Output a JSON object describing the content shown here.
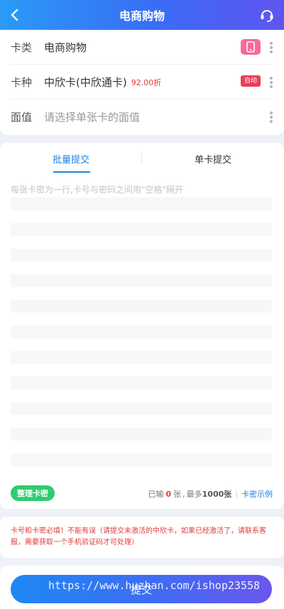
{
  "header": {
    "title": "电商购物",
    "back_icon": "chevron-left-icon",
    "service_icon": "headset-icon"
  },
  "form": {
    "card_type": {
      "label": "卡类",
      "value": "电商购物",
      "badge_icon": "phone-icon",
      "badge_color": "#f66a9c"
    },
    "card_kind": {
      "label": "卡种",
      "value": "中欣卡(中欣通卡)",
      "discount": "92.00折",
      "badge": "自动",
      "badge_color": "#ea3d5a"
    },
    "denomination": {
      "label": "面值",
      "placeholder": "请选择单张卡的面值"
    }
  },
  "tabs": [
    {
      "label": "批量提交",
      "active": true
    },
    {
      "label": "单卡提交",
      "active": false
    }
  ],
  "textarea": {
    "placeholder": "每张卡密为一行,卡号与密码之间用\"空格\"隔开"
  },
  "bottom_bar": {
    "organize_button": "整理卡密",
    "entered_prefix": "已输",
    "entered_count": "0",
    "entered_suffix": "张",
    "max_prefix": "最多",
    "max_count": "1000张",
    "example_link": "卡密示例"
  },
  "notice": "卡号和卡密必填！不能有误（请提交未激活的中欣卡，如果已经激活了，请联系客服，需要获取一个手机验证码才可处理）",
  "submit_label": "提交",
  "watermark": "https://www.huzhan.com/ishop23558",
  "colors": {
    "accent": "#1d83e6",
    "header_gradient_start": "#2a9bf6",
    "header_gradient_end": "#5f55f0",
    "green": "#2dcc6f",
    "red": "#e23b3b"
  }
}
